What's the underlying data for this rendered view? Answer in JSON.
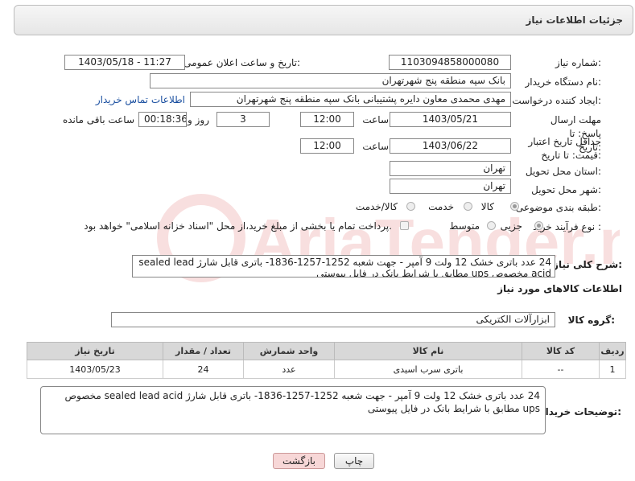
{
  "header": {
    "title": "جزئیات اطلاعات نیاز"
  },
  "fields": {
    "need_number_label": "شماره نیاز:",
    "need_number": "1103094858000080",
    "announce_label": "تاریخ و ساعت اعلان عمومی:",
    "announce_value": "1403/05/18 - 11:27",
    "buyer_org_label": "نام دستگاه خریدار:",
    "buyer_org": "بانک سپه منطقه پنج شهرتهران",
    "creator_label": "ایجاد کننده درخواست:",
    "creator": "مهدی محمدی معاون دایره پشتیبانی بانک سپه منطقه پنج شهرتهران",
    "contact_link": "اطلاعات تماس خریدار",
    "deadline_label": "مهلت ارسال پاسخ: تا تاریخ:",
    "deadline_date": "1403/05/21",
    "time_label": "ساعت",
    "deadline_time": "12:00",
    "days_value": "3",
    "days_label": "روز و",
    "remaining_time": "00:18:36",
    "remaining_label": "ساعت باقی مانده",
    "validity_label": "حداقل تاریخ اعتبار قیمت: تا تاریخ:",
    "validity_date": "1403/06/22",
    "validity_time": "12:00",
    "province_label": "استان محل تحویل:",
    "province": "تهران",
    "city_label": "شهر محل تحویل:",
    "city": "تهران",
    "category_label": "طبقه بندی موضوعی:",
    "category_options": [
      "کالا",
      "خدمت",
      "کالا/خدمت"
    ],
    "process_label": "نوع فرآیند خرید :",
    "process_options": [
      "جزیی",
      "متوسط"
    ],
    "payment_note": "پرداخت تمام یا بخشی از مبلغ خرید،از محل \"اسناد خزانه اسلامی\" خواهد بود."
  },
  "description": {
    "label": "شرح کلی نیاز:",
    "text": "24 عدد باتری خشک 12 ولت 9 آمپر - جهت شعبه 1252-1257-1836- باتری قابل شارژ sealed lead acid مخصوص ups مطابق با شرایط بانک در فایل پیوستی"
  },
  "goods_section": {
    "header": "اطلاعات کالاهای مورد نیاز",
    "group_label": "گروه کالا:",
    "group_value": "ابزارآلات الکتریکی"
  },
  "table": {
    "headers": [
      "ردیف",
      "کد کالا",
      "نام کالا",
      "واحد شمارش",
      "تعداد / مقدار",
      "تاریخ نیاز"
    ],
    "rows": [
      [
        "1",
        "--",
        "باتری سرب اسیدی",
        "عدد",
        "24",
        "1403/05/23"
      ]
    ]
  },
  "buyer_notes": {
    "label": "توضیحات خریدار:",
    "text": "24 عدد باتری خشک 12 ولت 9 آمپر - جهت شعبه 1252-1257-1836- باتری قابل شارژ sealed lead acid مخصوص ups مطابق با شرایط بانک در فایل پیوستی"
  },
  "buttons": {
    "print": "چاپ",
    "back": "بازگشت"
  },
  "watermark": {
    "text": "AriaTender.net"
  },
  "colors": {
    "link": "#1a4fa0",
    "back_button_bg": "#f7d7d7",
    "header_bg": "#e6e6e6"
  }
}
